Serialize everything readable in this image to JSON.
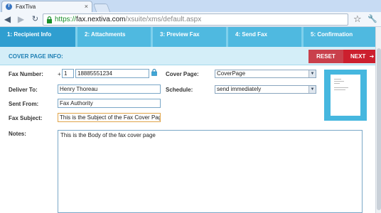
{
  "browser": {
    "tab_title": "FaxTiva",
    "url_https": "https://",
    "url_host": "fax.nextiva.com",
    "url_path": "/xsuite/xms/default.aspx"
  },
  "steps": [
    {
      "label": "1: Recipient Info",
      "active": true
    },
    {
      "label": "2: Attachments",
      "active": false
    },
    {
      "label": "3: Preview Fax",
      "active": false
    },
    {
      "label": "4: Send Fax",
      "active": false
    },
    {
      "label": "5: Confirmation",
      "active": false
    }
  ],
  "cover": {
    "title": "COVER PAGE INFO:",
    "reset_label": "RESET",
    "next_label": "NEXT",
    "next_arrow": "➔"
  },
  "form": {
    "fax_number_label": "Fax Number:",
    "plus": "+",
    "country_code": "1",
    "fax_number": "18885551234",
    "deliver_to_label": "Deliver To:",
    "deliver_to": "Henry Thoreau",
    "sent_from_label": "Sent From:",
    "sent_from": "Fax Authority",
    "fax_subject_label": "Fax Subject:",
    "fax_subject": "This is the Subject of the Fax Cover Page",
    "notes_label": "Notes:",
    "notes": "This is the Body of the fax cover page",
    "cover_page_label": "Cover Page:",
    "cover_page_value": "CoverPage",
    "schedule_label": "Schedule:",
    "schedule_value": "send immediately"
  },
  "colors": {
    "step_bar": "#4fb9e0",
    "step_active": "#2f9ed0",
    "reset": "#c9404c",
    "next": "#cc1f2e",
    "accent_text": "#1e7fb4"
  }
}
